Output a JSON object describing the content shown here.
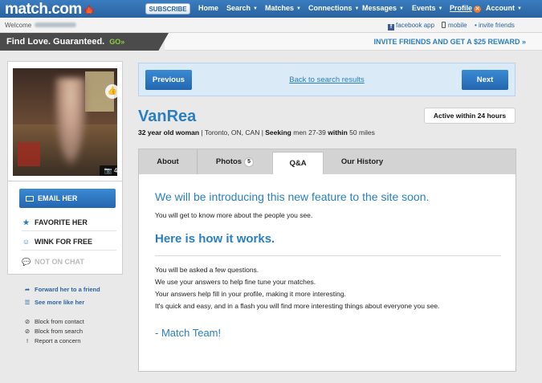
{
  "header": {
    "logo": "match.com",
    "subscribe_label": "SUBSCRIBE",
    "nav": [
      {
        "label": "Home",
        "has_caret": false
      },
      {
        "label": "Search",
        "has_caret": true
      },
      {
        "label": "Matches",
        "has_caret": true
      },
      {
        "label": "Connections",
        "has_caret": true
      },
      {
        "label": "Messages",
        "has_caret": true
      },
      {
        "label": "Events",
        "has_caret": true
      },
      {
        "label": "Profile",
        "has_caret": true
      },
      {
        "label": "Account",
        "has_caret": true
      }
    ],
    "profile_badge": "✕"
  },
  "subbar": {
    "welcome": "Welcome",
    "facebook_app": "facebook app",
    "mobile": "mobile",
    "invite_friends": "• invite friends"
  },
  "promo": {
    "tagline": "Find Love. Guaranteed.",
    "go": "GO»",
    "invite": "INVITE FRIENDS AND GET A $25 REWARD »"
  },
  "profile_photo": {
    "photo_count": "4"
  },
  "actions": {
    "email": "EMAIL HER",
    "favorite": "FAVORITE HER",
    "wink": "WINK FOR FREE",
    "chat": "NOT ON CHAT"
  },
  "links": {
    "forward": "Forward her to a friend",
    "see_more": "See more like her",
    "block_contact": "Block from contact",
    "block_search": "Block from search",
    "report": "Report a concern"
  },
  "pager": {
    "previous": "Previous",
    "back": "Back to search results",
    "next": "Next"
  },
  "profile": {
    "username": "VanRea",
    "age_gender": "32 year old woman",
    "location": " | Toronto, ON, CAN | ",
    "seeking_label": "Seeking",
    "seeking_value": " men 27-39 ",
    "within_label": "within",
    "within_value": " 50 miles",
    "active": "Active within 24 hours"
  },
  "tabs": [
    {
      "label": "About",
      "active": false
    },
    {
      "label": "Photos",
      "count": "5",
      "active": false
    },
    {
      "label": "Q&A",
      "active": true
    },
    {
      "label": "Our History",
      "active": false
    }
  ],
  "qa": {
    "intro_heading": "We will be introducing this new feature to the site soon.",
    "intro_text": "You will get to know more about the people you see.",
    "how_heading": "Here is how it works.",
    "lines": [
      "You will be asked a few questions.",
      "We use your answers to help fine tune your matches.",
      "Your answers help fill in your profile, making it more interesting.",
      "It's quick and easy, and in a flash you will find more interesting things about everyone you see."
    ],
    "signoff": "- Match Team!"
  },
  "icons": {
    "maple": "maple-leaf-icon",
    "like": "thumbs-up-icon",
    "camera": "camera-icon",
    "star": "star-icon",
    "wink": "smiley-icon",
    "chat": "chat-bubble-icon",
    "forward": "forward-arrow-icon",
    "list": "list-icon",
    "block": "block-icon",
    "report": "exclamation-icon"
  },
  "colors": {
    "brand_blue": "#2a62a0",
    "link_blue": "#2a7fc0",
    "go_green": "#8ccf3a",
    "panel_blue": "#dbeaf7"
  }
}
